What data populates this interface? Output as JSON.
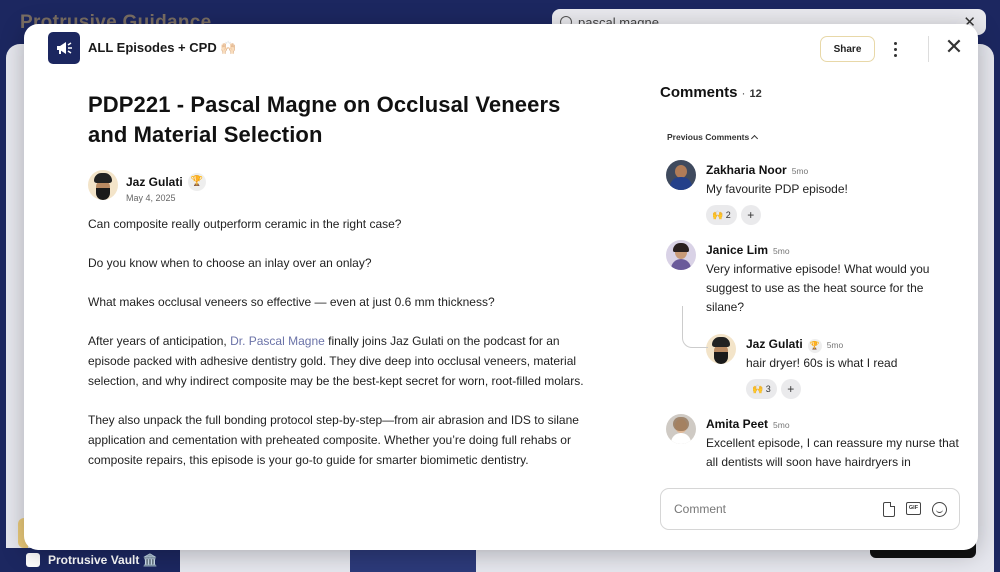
{
  "background": {
    "title": "Protrusive Guidance",
    "search_value": "pascal magne",
    "footer_label": "Protrusive Vault 🏛️"
  },
  "header": {
    "space_name": "ALL Episodes + CPD 🙌🏻",
    "share_label": "Share"
  },
  "post": {
    "title": "PDP221 - Pascal Magne on Occlusal Veneers and Material Selection",
    "author": "Jaz Gulati",
    "author_badge": "🏆",
    "date": "May 4, 2025",
    "p1": "Can composite really outperform ceramic in the right case?",
    "p2": "Do you know when to choose an inlay over an onlay?",
    "p3": "What makes occlusal veneers so effective — even at just 0.6 mm thickness?",
    "p4_before": "After years of anticipation, ",
    "p4_link": "Dr. Pascal Magne",
    "p4_after": " finally joins Jaz Gulati on the podcast for an episode packed with adhesive dentistry gold. They dive deep into occlusal veneers, material selection, and why indirect composite may be the best-kept secret for worn, root-filled molars.",
    "p5": "They also unpack the full bonding protocol step-by-step—from air abrasion and IDS to silane application and cementation with preheated composite. Whether you’re doing full rehabs or composite repairs, this episode is your go-to guide for smarter biomimetic dentistry."
  },
  "comments": {
    "heading": "Comments",
    "separator": "·",
    "count": "12",
    "previous_label": "Previous Comments",
    "items": [
      {
        "name": "Zakharia Noor",
        "time": "5mo",
        "text": "My favourite PDP episode!",
        "reaction": "🙌 2"
      },
      {
        "name": "Janice Lim",
        "time": "5mo",
        "text": "Very informative episode! What would you suggest to use as the heat source for the silane?"
      },
      {
        "name": "Jaz Gulati",
        "badge": "🏆",
        "time": "5mo",
        "text": "hair dryer! 60s is what I read",
        "reaction": "🙌 3"
      },
      {
        "name": "Amita Peet",
        "time": "5mo",
        "text": "Excellent episode, I can reassure my nurse that all dentists will soon have hairdryers in"
      }
    ],
    "add_reaction": "+",
    "input_placeholder": "Comment"
  },
  "colors": {
    "brand_navy": "#1c2760",
    "link": "#6b73a8",
    "share_border": "#e8d8a8"
  }
}
